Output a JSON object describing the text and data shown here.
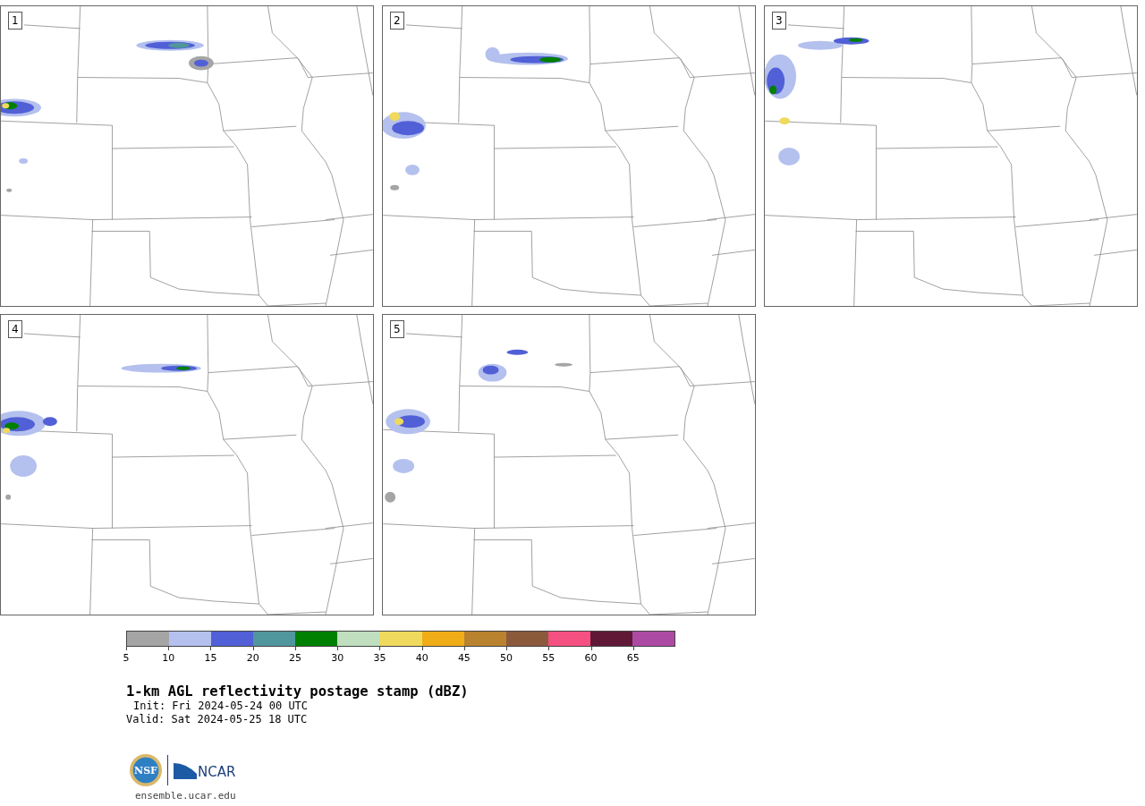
{
  "panels": [
    {
      "label": "1"
    },
    {
      "label": "2"
    },
    {
      "label": "3"
    },
    {
      "label": "4"
    },
    {
      "label": "5"
    }
  ],
  "colorbar": {
    "bins": [
      {
        "tick": "5",
        "color": "#a5a5a5"
      },
      {
        "tick": "10",
        "color": "#b4c0ee"
      },
      {
        "tick": "15",
        "color": "#5160d6"
      },
      {
        "tick": "20",
        "color": "#50969d"
      },
      {
        "tick": "25",
        "color": "#008000"
      },
      {
        "tick": "30",
        "color": "#bfdfbf"
      },
      {
        "tick": "35",
        "color": "#efda5e"
      },
      {
        "tick": "40",
        "color": "#f0ad17"
      },
      {
        "tick": "45",
        "color": "#b9822f"
      },
      {
        "tick": "50",
        "color": "#8b5a3c"
      },
      {
        "tick": "55",
        "color": "#f45081"
      },
      {
        "tick": "60",
        "color": "#611837"
      },
      {
        "tick": "65",
        "color": "#ad4ba4"
      }
    ]
  },
  "caption": {
    "title": "1-km AGL reflectivity postage stamp (dBZ)",
    "init": "Init: Fri 2024-05-24 00 UTC",
    "valid": "Valid: Sat 2024-05-25 18 UTC"
  },
  "footer": {
    "nsf_logo": "NSF",
    "ncar_logo": "NCAR",
    "url": "ensemble.ucar.edu"
  }
}
